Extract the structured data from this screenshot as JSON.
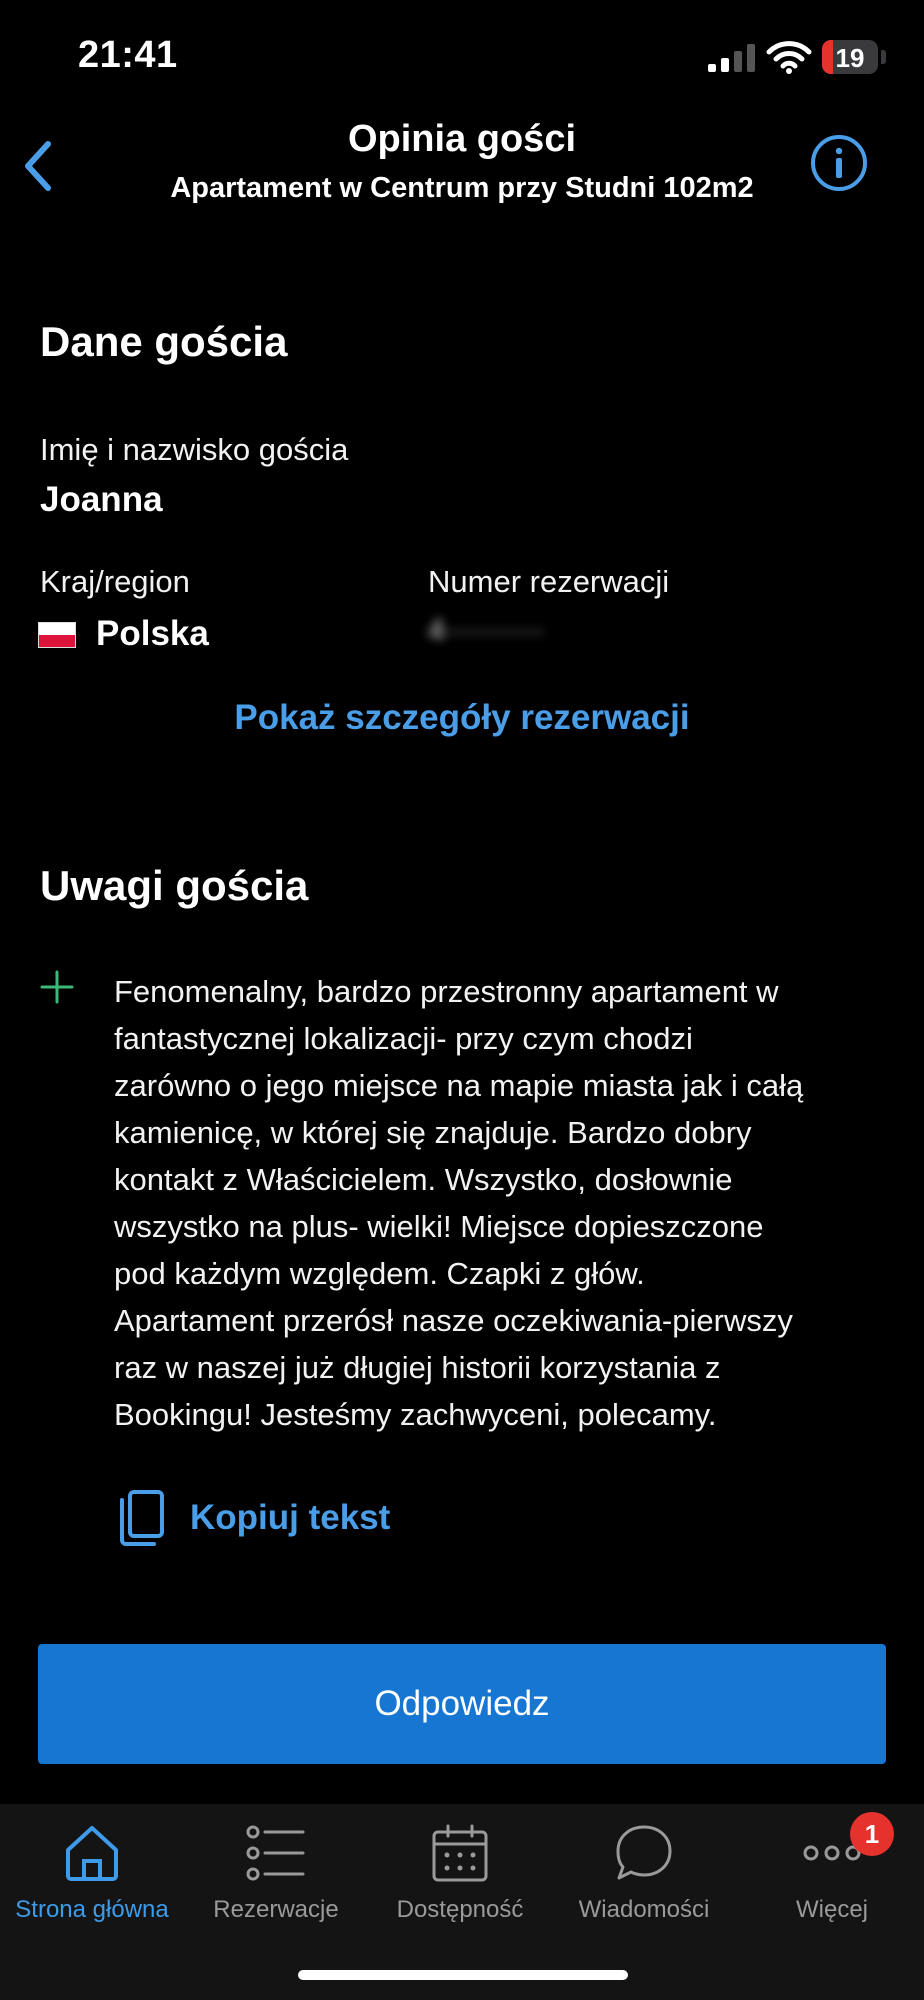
{
  "status_bar": {
    "time": "21:41",
    "battery_level": "19"
  },
  "header": {
    "title": "Opinia gości",
    "subtitle": "Apartament w Centrum przy Studni 102m2"
  },
  "guest": {
    "section_title": "Dane gościa",
    "name_label": "Imię i nazwisko gościa",
    "name_value": "Joanna",
    "country_label": "Kraj/region",
    "country_value": "Polska",
    "reservation_label": "Numer rezerwacji",
    "reservation_value": "4··········",
    "details_link": "Pokaż szczegóły rezerwacji"
  },
  "review": {
    "section_title": "Uwagi gościa",
    "positive_text": "Fenomenalny, bardzo przestronny apartament w\nfantastycznej lokalizacji- przy czym chodzi\nzarówno o jego miejsce na mapie miasta jak i całą\nkamienicę, w której się znajduje. Bardzo dobry\nkontakt z Właścicielem. Wszystko, dosłownie\nwszystko na plus- wielki!  Miejsce dopieszczone\npod każdym względem. Czapki z głów.\nApartament przerósł nasze oczekiwania-pierwszy\nraz w naszej już długiej historii korzystania z\nBookingu! Jesteśmy zachwyceni, polecamy.",
    "copy_label": "Kopiuj tekst"
  },
  "reply_button_label": "Odpowiedz",
  "tabs": [
    {
      "label": "Strona główna",
      "icon": "home-icon"
    },
    {
      "label": "Rezerwacje",
      "icon": "list-icon"
    },
    {
      "label": "Dostępność",
      "icon": "calendar-icon"
    },
    {
      "label": "Wiadomości",
      "icon": "chat-bubble-icon"
    },
    {
      "label": "Więcej",
      "icon": "more-icon"
    }
  ],
  "more_badge": "1",
  "colors": {
    "accent": "#4a9ee8",
    "button": "#1676d2",
    "positive": "#3cb878",
    "badge": "#e5322d"
  }
}
